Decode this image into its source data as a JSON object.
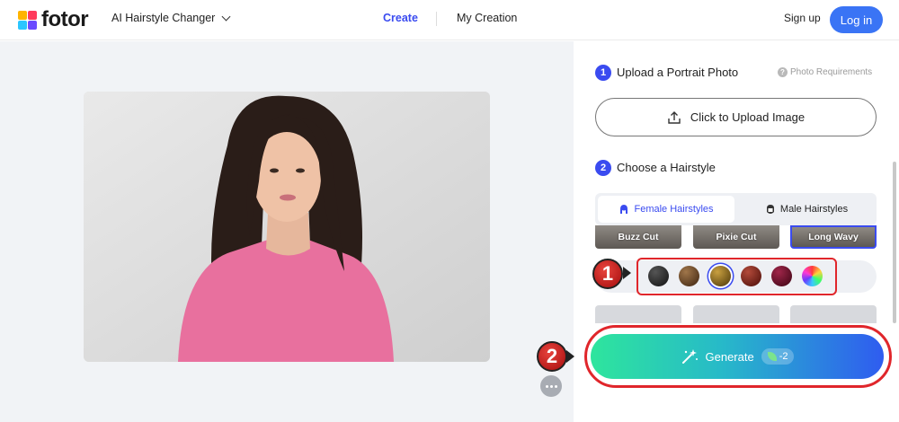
{
  "header": {
    "brand": "fotor",
    "tool_menu": "AI Hairstyle Changer",
    "nav": {
      "create": "Create",
      "my_creation": "My Creation"
    },
    "signup": "Sign up",
    "login": "Log in"
  },
  "panel": {
    "step1": {
      "num": "1",
      "title": "Upload a Portrait Photo",
      "requirements": "Photo Requirements"
    },
    "upload_label": "Click to Upload Image",
    "step2": {
      "num": "2",
      "title": "Choose a Hairstyle"
    },
    "tabs": {
      "female": "Female Hairstyles",
      "male": "Male Hairstyles"
    },
    "styles": [
      {
        "label": "Buzz Cut"
      },
      {
        "label": "Pixie Cut"
      },
      {
        "label": "Long Wavy",
        "selected": true
      }
    ],
    "colors": [
      "#1b1b1b",
      "#5a3a1f",
      "#7a5a14",
      "#6b1a12",
      "#5e0b22",
      "rainbow"
    ],
    "selected_color_index": 2,
    "generate_label": "Generate",
    "generate_cost": "-2"
  },
  "annotations": {
    "marker1": "1",
    "marker2": "2"
  }
}
